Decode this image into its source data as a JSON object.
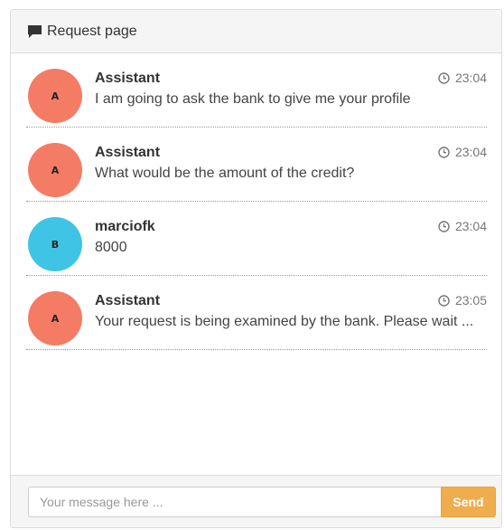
{
  "header": {
    "icon": "comment-icon",
    "title": "Request page"
  },
  "messages": [
    {
      "avatar_letter": "A",
      "avatar_color": "#f47c65",
      "author": "Assistant",
      "time": "23:04",
      "text": "I am going to ask the bank to give me your profile"
    },
    {
      "avatar_letter": "A",
      "avatar_color": "#f47c65",
      "author": "Assistant",
      "time": "23:04",
      "text": "What would be the amount of the credit?"
    },
    {
      "avatar_letter": "B",
      "avatar_color": "#3fc4e5",
      "author": "marciofk",
      "time": "23:04",
      "text": "8000"
    },
    {
      "avatar_letter": "A",
      "avatar_color": "#f47c65",
      "author": "Assistant",
      "time": "23:05",
      "text": "Your request is being examined by the bank. Please wait ..."
    }
  ],
  "footer": {
    "input_placeholder": "Your message here ...",
    "input_value": "",
    "send_label": "Send",
    "send_color": "#f0ad4e"
  }
}
